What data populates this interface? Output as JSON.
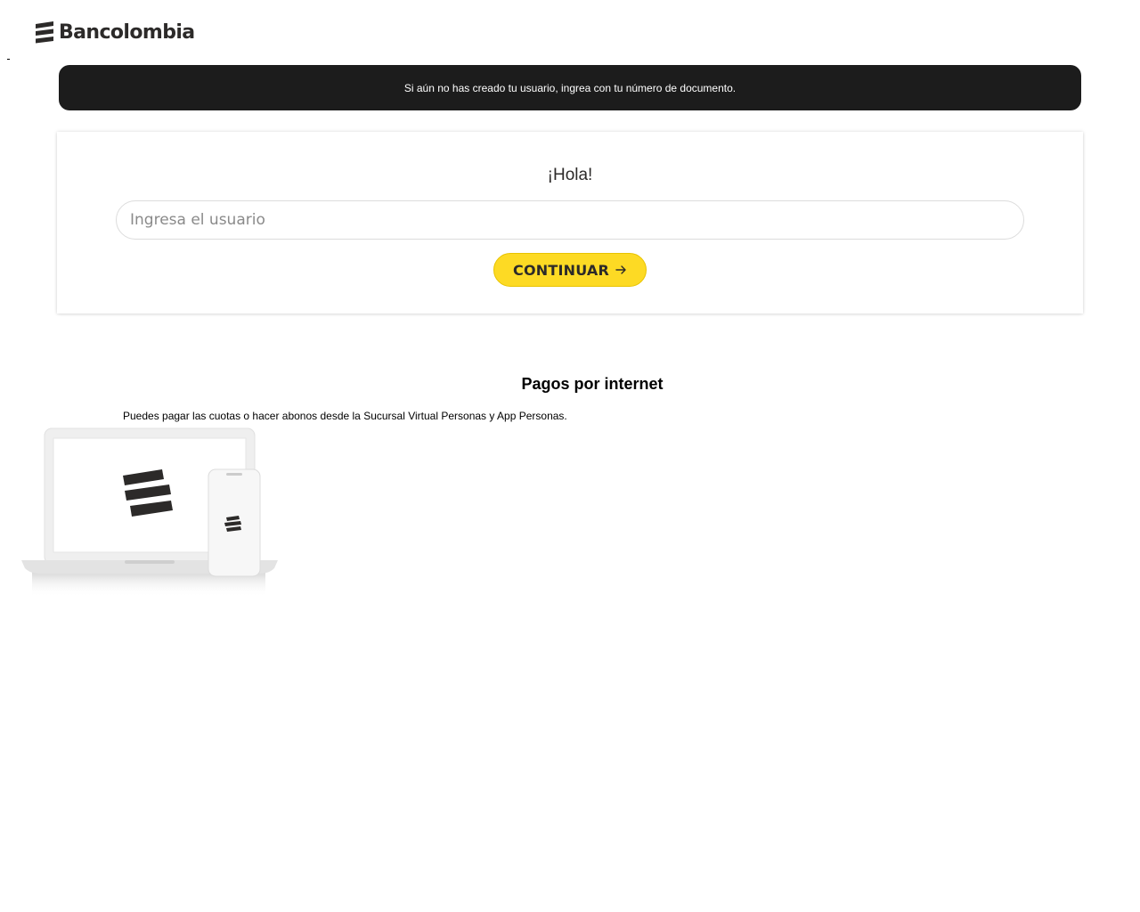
{
  "header": {
    "logo_text": "Bancolombia",
    "logo_icon": "bancolombia-logo-icon"
  },
  "notice": {
    "text": "Si aún no has creado tu usuario, ingrea con tu número de documento."
  },
  "login": {
    "greeting": "¡Hola!",
    "username_placeholder": "Ingresa el usuario",
    "username_value": "",
    "continue_label": "CONTINUAR",
    "continue_icon": "arrow-right-icon"
  },
  "payments": {
    "title": "Pagos por internet",
    "description": "Puedes pagar las cuotas o hacer abonos desde la Sucursal Virtual Personas y App Personas.",
    "image_icon": "laptop-and-phone-illustration"
  },
  "colors": {
    "brand_yellow": "#fdda24",
    "banner_dark": "#1c1c1c",
    "text_dark": "#2c2a29"
  }
}
